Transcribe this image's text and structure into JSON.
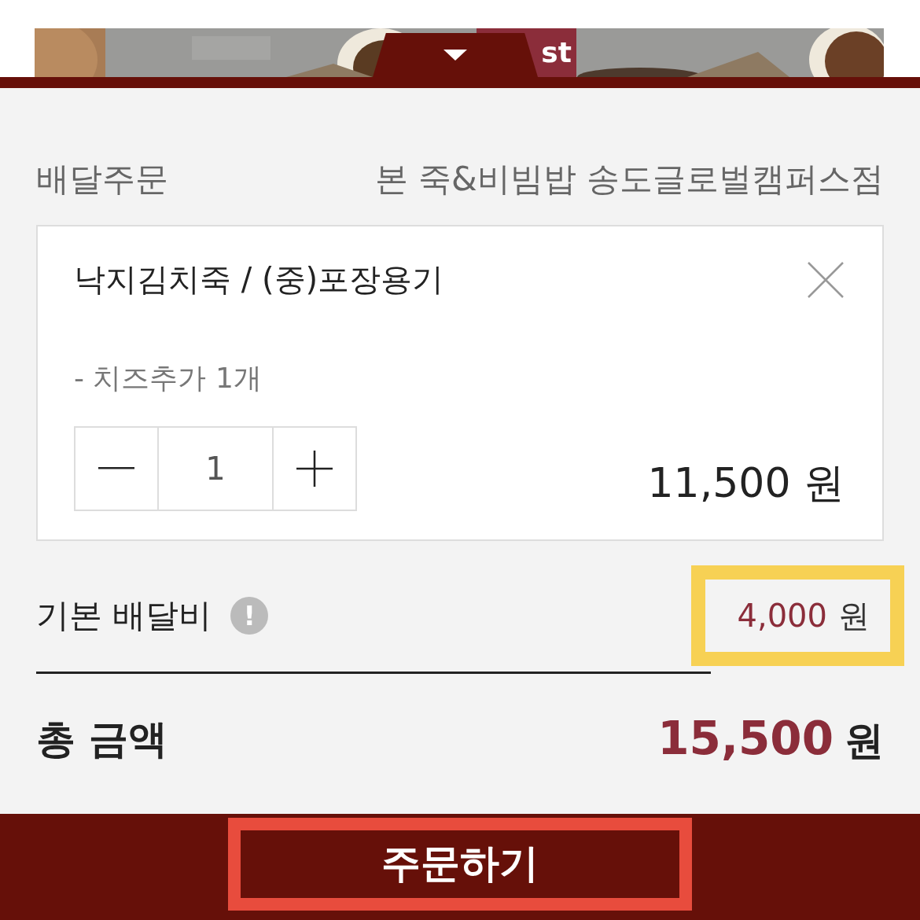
{
  "banner": {
    "kind": "picture",
    "badge": "st"
  },
  "order": {
    "type": "배달주문",
    "store": "본 죽&비빔밥 송도글로벌캠퍼스점"
  },
  "cart_items": [
    {
      "name": "낙지김치죽 / (중)포장용기",
      "options": [
        "- 치즈추가 1개"
      ],
      "quantity": "1",
      "price": "11,500 원"
    }
  ],
  "delivery_fee": {
    "label": "기본 배달비",
    "info_icon": "!",
    "amount": "4,000",
    "unit": "원",
    "highlighted": true
  },
  "total": {
    "label": "총 금액",
    "amount": "15,500",
    "unit": "원"
  },
  "order_button": {
    "label": "주문하기",
    "highlighted": true
  }
}
